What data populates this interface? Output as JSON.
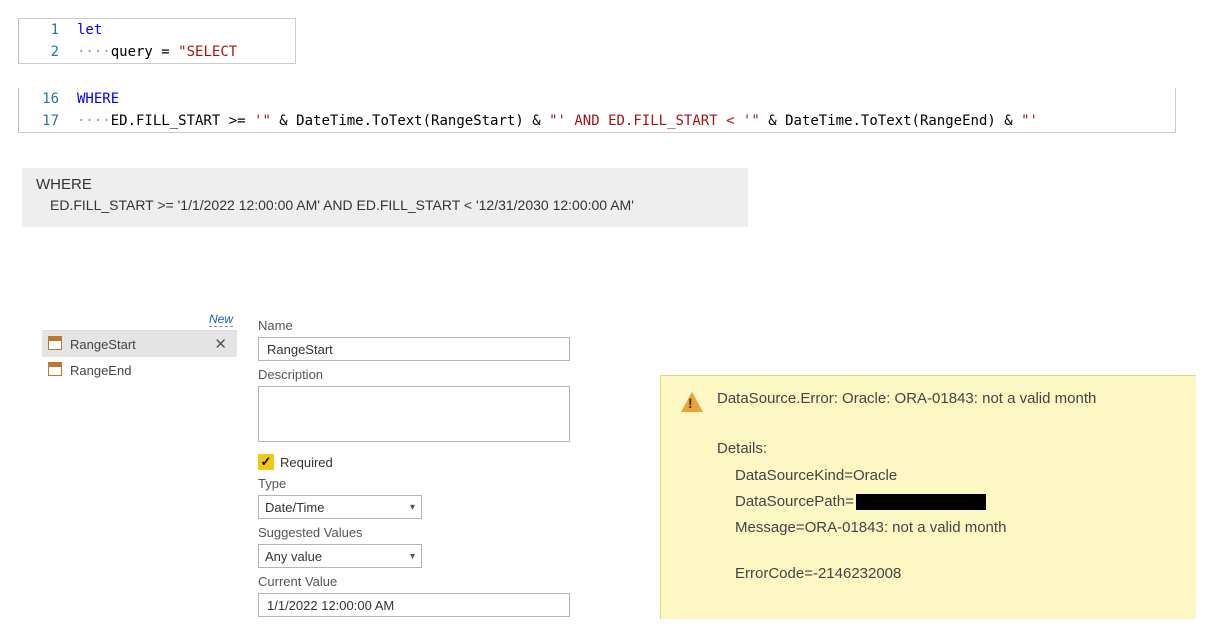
{
  "code": {
    "lines": [
      {
        "num": "1",
        "tokens": [
          {
            "cls": "kw",
            "t": "let"
          }
        ]
      },
      {
        "num": "2",
        "tokens": [
          {
            "cls": "dots",
            "t": "····"
          },
          {
            "cls": "col",
            "t": "query"
          },
          {
            "cls": "op",
            "t": " = "
          },
          {
            "cls": "str",
            "t": "\"SELECT"
          }
        ]
      }
    ],
    "lines2": [
      {
        "num": "16",
        "tokens": [
          {
            "cls": "kw",
            "t": "WHERE"
          }
        ]
      },
      {
        "num": "17",
        "tokens": [
          {
            "cls": "dots",
            "t": "····"
          },
          {
            "cls": "col",
            "t": "ED.FILL_START"
          },
          {
            "cls": "op",
            "t": " >= "
          },
          {
            "cls": "str",
            "t": "'\""
          },
          {
            "cls": "op",
            "t": " & "
          },
          {
            "cls": "fn",
            "t": "DateTime.ToText"
          },
          {
            "cls": "op",
            "t": "("
          },
          {
            "cls": "col",
            "t": "RangeStart"
          },
          {
            "cls": "op",
            "t": ") & "
          },
          {
            "cls": "str",
            "t": "\"' AND ED.FILL_START < '\""
          },
          {
            "cls": "op",
            "t": " & "
          },
          {
            "cls": "fn",
            "t": "DateTime.ToText"
          },
          {
            "cls": "op",
            "t": "("
          },
          {
            "cls": "col",
            "t": "RangeEnd"
          },
          {
            "cls": "op",
            "t": ") & "
          },
          {
            "cls": "str",
            "t": "\"'"
          }
        ]
      }
    ]
  },
  "resolved": {
    "line1": "WHERE",
    "line2": "ED.FILL_START >= '1/1/2022 12:00:00 AM' AND ED.FILL_START < '12/31/2030 12:00:00 AM'"
  },
  "params": {
    "new_label": "New",
    "items": [
      {
        "label": "RangeStart",
        "selected": true
      },
      {
        "label": "RangeEnd",
        "selected": false
      }
    ]
  },
  "form": {
    "name_label": "Name",
    "name_value": "RangeStart",
    "desc_label": "Description",
    "required_label": "Required",
    "required_checked": true,
    "type_label": "Type",
    "type_value": "Date/Time",
    "suggested_label": "Suggested Values",
    "suggested_value": "Any value",
    "current_label": "Current Value",
    "current_value": "1/1/2022 12:00:00 AM"
  },
  "error": {
    "title": "DataSource.Error: Oracle: ORA-01843: not a valid month",
    "details_label": "Details:",
    "kind": "DataSourceKind=Oracle",
    "path_prefix": "DataSourcePath=",
    "message": "Message=ORA-01843: not a valid month",
    "errorcode": "ErrorCode=-2146232008"
  }
}
